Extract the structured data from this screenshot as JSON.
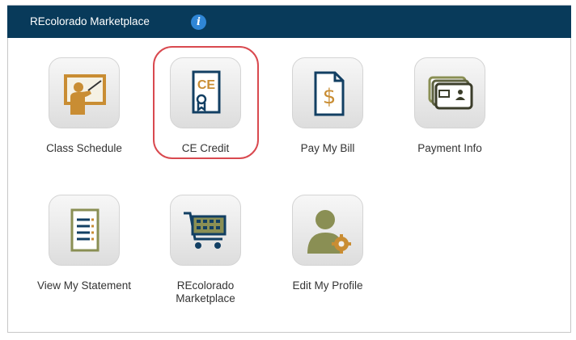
{
  "header": {
    "title": "REcolorado Marketplace",
    "info_icon": "info-icon"
  },
  "tiles": [
    {
      "label": "Class Schedule",
      "icon": "teacher-board-icon"
    },
    {
      "label": "CE Credit",
      "icon": "ce-certificate-icon"
    },
    {
      "label": "Pay My Bill",
      "icon": "dollar-document-icon"
    },
    {
      "label": "Payment Info",
      "icon": "credit-cards-icon"
    },
    {
      "label": "View My Statement",
      "icon": "statement-document-icon"
    },
    {
      "label": "REcolorado\nMarketplace",
      "icon": "shopping-cart-icon"
    },
    {
      "label": "Edit My Profile",
      "icon": "user-gear-icon"
    }
  ],
  "colors": {
    "header_bg": "#083a5a",
    "icon_gold": "#c98d33",
    "icon_navy": "#123f63",
    "icon_olive": "#8a8f54",
    "highlight": "#d9494f"
  }
}
